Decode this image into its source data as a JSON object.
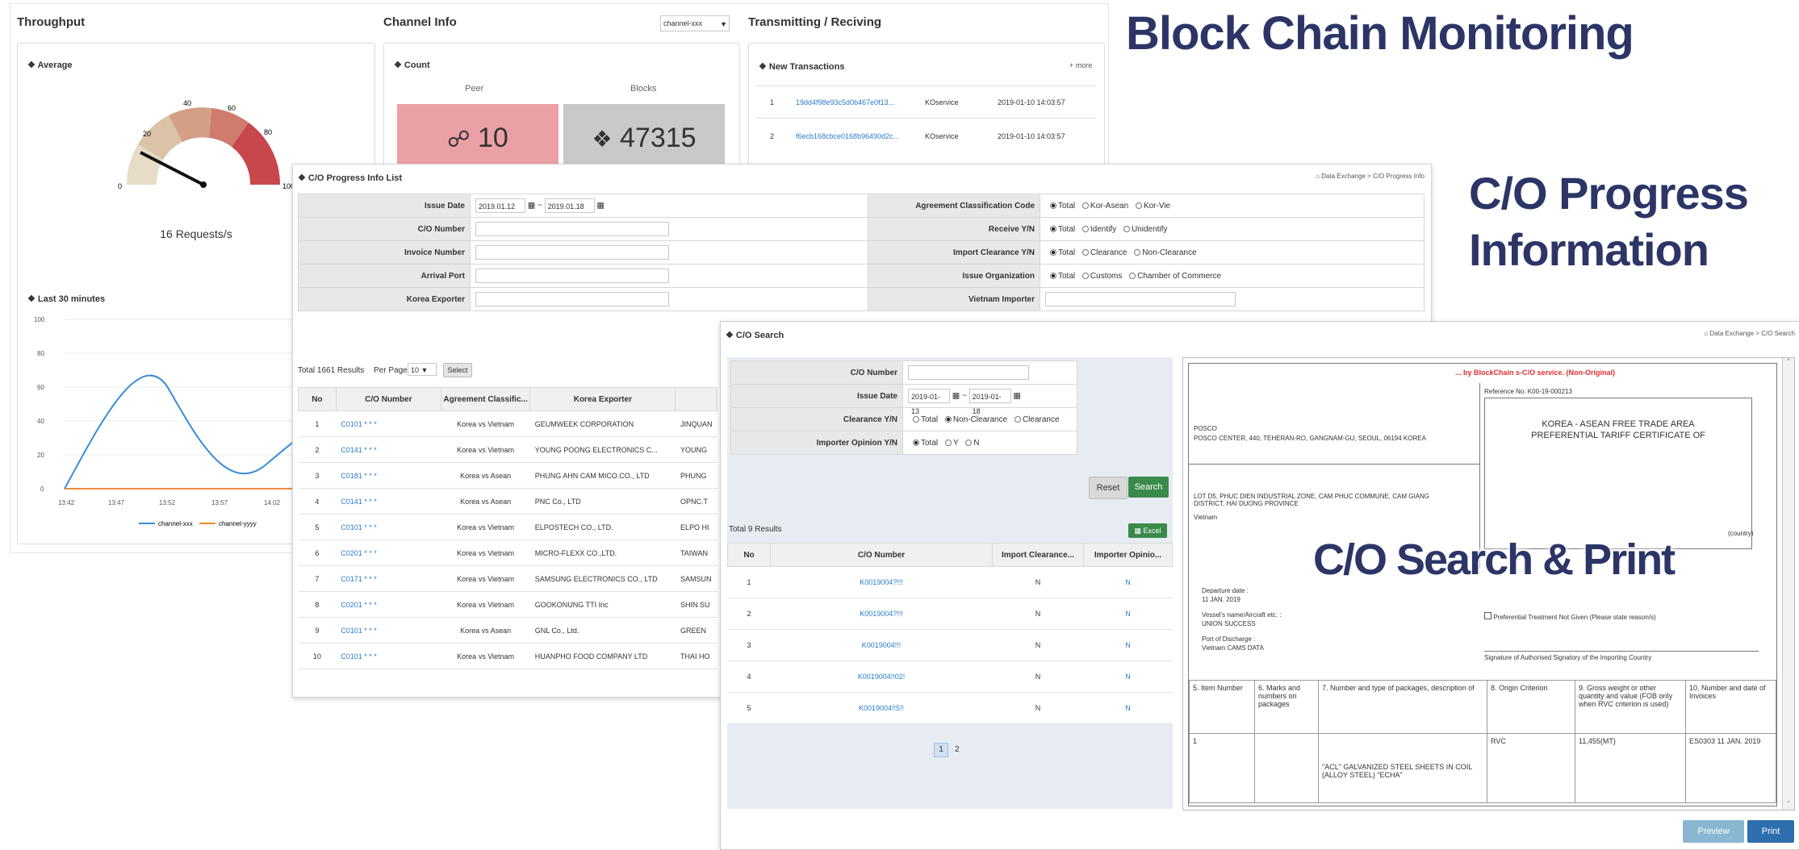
{
  "titles": {
    "monitoring": "Block Chain Monitoring",
    "progress_line1": "C/O Progress",
    "progress_line2": "Information",
    "search": "C/O Search & Print"
  },
  "monitoring": {
    "throughput_title": "Throughput",
    "average_label": "Average",
    "gauge_ticks": [
      "0",
      "20",
      "40",
      "60",
      "80",
      "100"
    ],
    "gauge_value": "16 Requests/s",
    "last_minutes_label": "Last 30 minutes",
    "chart_ylabels": [
      "100",
      "80",
      "60",
      "40",
      "20",
      "0"
    ],
    "chart_xlabels": [
      "13:42",
      "13:47",
      "13:52",
      "13:57",
      "14:02"
    ],
    "legend": [
      "channel-xxx",
      "channel-yyyy"
    ],
    "channel_title": "Channel Info",
    "channel_select": "channel-xxx",
    "count_label": "Count",
    "peer_label": "Peer",
    "peer_value": "10",
    "blocks_label": "Blocks",
    "blocks_value": "47315",
    "tx_title": "Transmitting / Reciving",
    "new_tx_label": "New Transactions",
    "more_label": "+ more",
    "transactions": [
      {
        "no": "1",
        "hash": "19dd4f98e93c5d0b467e0f13...",
        "service": "KOservice",
        "time": "2019-01-10 14:03:57"
      },
      {
        "no": "2",
        "hash": "f6ecb168cbce0168b96490d2c...",
        "service": "KOservice",
        "time": "2019-01-10 14:03:57"
      }
    ]
  },
  "progress": {
    "header": "C/O Progress Info List",
    "breadcrumb": "Data Exchange > C/O Progress Info",
    "issue_date_label": "Issue Date",
    "issue_date_from": "2019.01.12",
    "issue_date_to": "2019.01.18",
    "co_number_label": "C/O Number",
    "invoice_number_label": "Invoice Number",
    "arrival_port_label": "Arrival Port",
    "korea_exporter_label": "Korea Exporter",
    "agreement_label": "Agreement Classification Code",
    "agreement_options": [
      "Total",
      "Kor-Asean",
      "Kor-Vie"
    ],
    "receive_label": "Receive Y/N",
    "receive_options": [
      "Total",
      "Identify",
      "Unidentify"
    ],
    "import_clearance_label": "Import Clearance Y/N",
    "import_clearance_options": [
      "Total",
      "Clearance",
      "Non-Clearance"
    ],
    "issue_org_label": "Issue Organization",
    "issue_org_options": [
      "Total",
      "Customs",
      "Chamber of Commerce"
    ],
    "vietnam_importer_label": "Vietnam Importer",
    "total_text": "Total 1661 Results",
    "per_page_label": "Per Page",
    "per_page_value": "10",
    "select_btn": "Select",
    "columns": [
      "No",
      "C/O Number",
      "Agreement Classific...",
      "Korea Exporter"
    ],
    "rows": [
      {
        "no": "1",
        "co": "C0101 * * *",
        "agreement": "Korea vs Vietnam",
        "exporter": "GEUMWEEK CORPORATION",
        "extra": "JINQUAN"
      },
      {
        "no": "2",
        "co": "C0141 * * *",
        "agreement": "Korea vs Vietnam",
        "exporter": "YOUNG POONG ELECTRONICS C...",
        "extra": "YOUNG"
      },
      {
        "no": "3",
        "co": "C0181 * * *",
        "agreement": "Korea vs Asean",
        "exporter": "PHUNG AHN CAM MICO.CO., LTD",
        "extra": "PHUNG"
      },
      {
        "no": "4",
        "co": "C0141 * * *",
        "agreement": "Korea vs Asean",
        "exporter": "PNC Co., LTD",
        "extra": "OPNC.T"
      },
      {
        "no": "5",
        "co": "C0101 * * *",
        "agreement": "Korea vs Vietnam",
        "exporter": "ELPOSTECH CO., LTD.",
        "extra": "ELPO HI"
      },
      {
        "no": "6",
        "co": "C0201 * * *",
        "agreement": "Korea vs Vietnam",
        "exporter": "MICRO-FLEXX CO.,LTD.",
        "extra": "TAIWAN"
      },
      {
        "no": "7",
        "co": "C0171 * * *",
        "agreement": "Korea vs Vietnam",
        "exporter": "SAMSUNG ELECTRONICS CO., LTD",
        "extra": "SAMSUN"
      },
      {
        "no": "8",
        "co": "C0201 * * *",
        "agreement": "Korea vs Vietnam",
        "exporter": "GOOKONUNG TTI Inc",
        "extra": "SHIN SU"
      },
      {
        "no": "9",
        "co": "C0101 * * *",
        "agreement": "Korea vs Asean",
        "exporter": "GNL Co., Ltd.",
        "extra": "GREEN"
      },
      {
        "no": "10",
        "co": "C0101 * * *",
        "agreement": "Korea vs Vietnam",
        "exporter": "HUANPHO FOOD COMPANY LTD",
        "extra": "THAI HO"
      }
    ]
  },
  "search": {
    "header": "C/O Search",
    "breadcrumb": "Data Exchange > C/O Search",
    "co_number_label": "C/O Number",
    "issue_date_label": "Issue Date",
    "issue_from": "2019-01-13",
    "issue_to": "2019-01-18",
    "clearance_label": "Clearance Y/N",
    "clearance_options": [
      "Total",
      "Non-Clearance",
      "Clearance"
    ],
    "importer_opinion_label": "Importer Opinion Y/N",
    "importer_options": [
      "Total",
      "Y",
      "N"
    ],
    "reset_btn": "Reset",
    "search_btn": "Search",
    "total_text": "Total 9 Results",
    "excel_btn": "Excel",
    "columns": [
      "No",
      "C/O Number",
      "Import Clearance...",
      "Importer Opinio..."
    ],
    "rows": [
      {
        "no": "1",
        "co": "K0019004?!!!",
        "clear": "N",
        "opinion": "N"
      },
      {
        "no": "2",
        "co": "K0019004?!!!",
        "clear": "N",
        "opinion": "N"
      },
      {
        "no": "3",
        "co": "K0019004!!!",
        "clear": "N",
        "opinion": "N"
      },
      {
        "no": "4",
        "co": "K0019004!!02!",
        "clear": "N",
        "opinion": "N"
      },
      {
        "no": "5",
        "co": "K0019004!!5!!",
        "clear": "N",
        "opinion": "N"
      }
    ],
    "pages": [
      "1",
      "2"
    ],
    "preview_btn": "Preview",
    "print_btn": "Print"
  },
  "certificate": {
    "notice": "... by BlockChain s-C/O service. (Non-Original)",
    "reference": "Reference No. K00-19-000213",
    "title_line1": "KOREA - ASEAN FREE TRADE AREA",
    "title_line2": "PREFERENTIAL TARIFF CERTIFICATE OF",
    "exporter_name": "POSCO",
    "exporter_addr": "POSCO CENTER, 440, TEHERAN-RO, GANGNAM-GU, SEOUL, 06194 KOREA",
    "consignee_addr": "LOT D5, PHUC DIEN INDUSTRIAL ZONE, CAM PHUC COMMUNE, CAM GIANG DISTRICT, HAI DUONG PROVINCE",
    "consignee_country": "Vietnam",
    "country_label": "(country)",
    "departure_label": "Departure date :",
    "departure_value": "11 JAN. 2019",
    "vessel_label": "Vessel's name/Aircraft etc. :",
    "vessel_value": "UNION SUCCESS",
    "port_label": "Port of Discharge :",
    "port_value": "Vietnam CAMS DATA",
    "preferential_label": "Preferential Treatment Not Given (Please state reason/s)",
    "signature_label": "Signature of Authorised Signatory of the Importing Country",
    "col_headers": [
      "5. Item Number",
      "6. Marks and numbers on packages",
      "7. Number and type of packages, description of",
      "8. Origin Criterion",
      "9. Gross weight or other quantity and value (FOB only when RVC criterion is used)",
      "10. Number and date of Invoices"
    ],
    "row_item": "1",
    "row_desc": "\"ACL\" GALVANIZED STEEL SHEETS IN COIL (ALLOY STEEL) \"ECHA\"",
    "row_criterion": "RVC",
    "row_weight": "11,455(MT)",
    "row_invoice": "ES0303 11 JAN. 2019"
  }
}
